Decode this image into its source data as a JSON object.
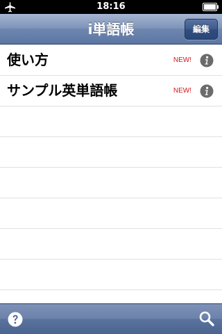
{
  "status_bar": {
    "time": "18:16",
    "airplane_icon": "airplane-icon",
    "battery_icon": "battery-icon"
  },
  "nav": {
    "title": "i単語帳",
    "edit_label": "編集"
  },
  "list": {
    "items": [
      {
        "title": "使い方",
        "badge": "NEW!",
        "accessory_icon": "info-icon"
      },
      {
        "title": "サンプル英単語帳",
        "badge": "NEW!",
        "accessory_icon": "info-icon"
      }
    ]
  },
  "toolbar": {
    "help_icon": "help-icon",
    "search_icon": "search-icon"
  },
  "colors": {
    "nav_bar": "#6f87af",
    "badge": "#cc1a1a",
    "info_icon": "#6b6b6b"
  }
}
